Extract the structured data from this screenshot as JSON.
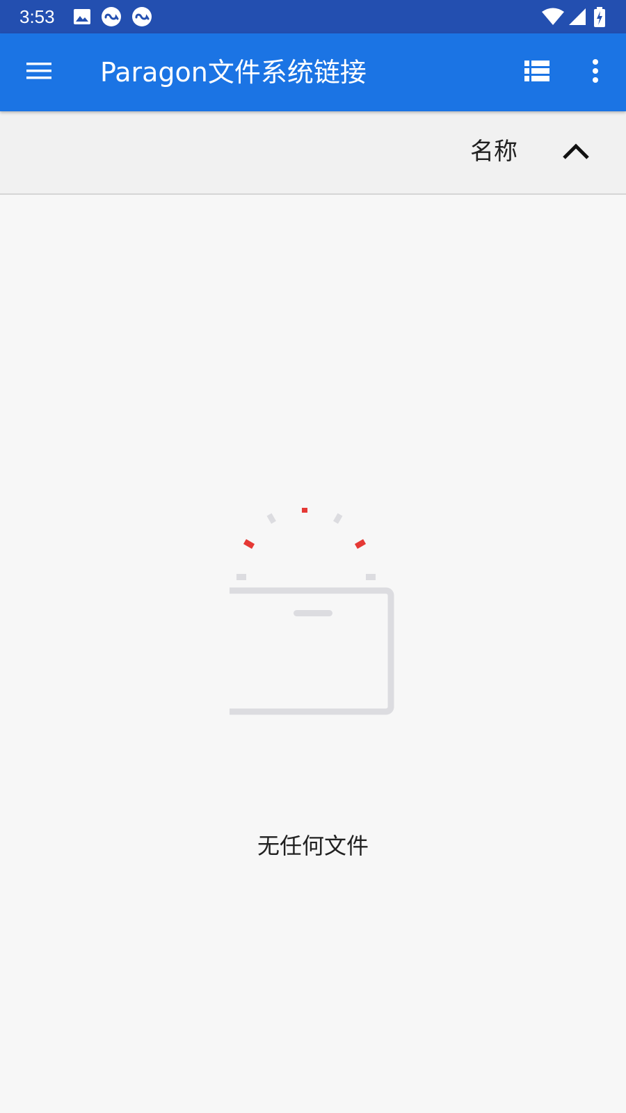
{
  "status_bar": {
    "time": "3:53",
    "icons": [
      "image-icon",
      "link-circle-icon",
      "link-circle-icon",
      "wifi-icon",
      "cell-signal-icon",
      "battery-charging-icon"
    ]
  },
  "app_bar": {
    "title": "Paragon文件系统链接",
    "menu_icon": "hamburger-menu-icon",
    "view_icon": "list-view-icon",
    "overflow_icon": "more-vert-icon",
    "color": "#1b74e4"
  },
  "sort_bar": {
    "label": "名称",
    "direction_icon": "chevron-up-icon"
  },
  "empty_state": {
    "message": "无任何文件",
    "illustration": "empty-folder-icon",
    "accent_color": "#e53935",
    "outline_color": "#dcdce0"
  }
}
